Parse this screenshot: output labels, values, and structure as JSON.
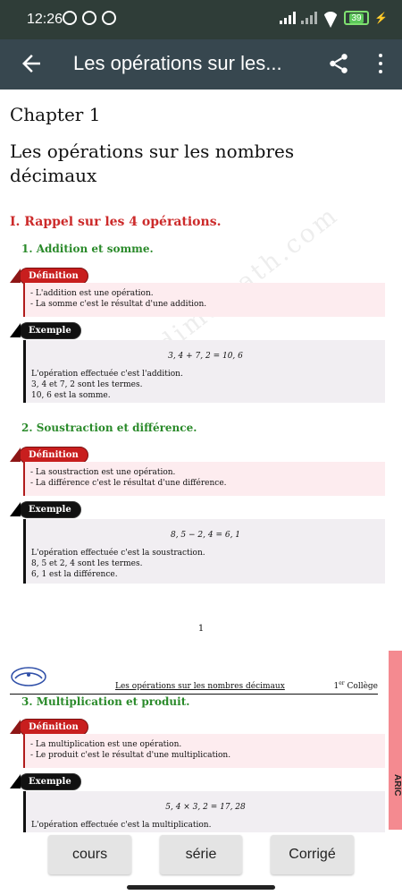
{
  "status_bar": {
    "time": "12:26",
    "battery": "39"
  },
  "app_bar": {
    "title": "Les opérations sur les..."
  },
  "document": {
    "chapter": "Chapter 1",
    "title": "Les opérations sur les nombres décimaux",
    "section": "I.  Rappel sur les 4 opérations.",
    "watermark": "www.dimamath.com",
    "subsections": [
      {
        "heading": "1.  Addition et somme.",
        "definition_label": "Définition",
        "definition_lines": [
          "- L'addition est une opération.",
          "- La somme c'est le résultat d'une addition."
        ],
        "example_label": "Exemple",
        "equation": "3, 4 + 7, 2 = 10, 6",
        "example_lines": [
          "L'opération effectuée c'est l'addition.",
          "3, 4 et 7, 2 sont les termes.",
          "10, 6 est la somme."
        ]
      },
      {
        "heading": "2.  Soustraction et différence.",
        "definition_label": "Définition",
        "definition_lines": [
          "- La soustraction est une opération.",
          "- La différence c'est le résultat d'une différence."
        ],
        "example_label": "Exemple",
        "equation": "8, 5 − 2, 4 = 6, 1",
        "example_lines": [
          "L'opération effectuée c'est la soustraction.",
          "8, 5 et 2, 4 sont les termes.",
          "6, 1 est la différence."
        ]
      },
      {
        "heading": "3.  Multiplication et produit.",
        "definition_label": "Définition",
        "definition_lines": [
          "- La multiplication est une opération.",
          "- Le produit c'est le résultat d'une multiplication."
        ],
        "example_label": "Exemple",
        "equation": "5, 4 × 3, 2 = 17, 28",
        "example_lines": [
          "L'opération effectuée c'est la multiplication."
        ]
      }
    ],
    "page_number": "1",
    "running_header": {
      "title": "Les opérations sur les nombres décimaux",
      "level_prefix": "1",
      "level_sup": "er",
      "level_suffix": " Collège"
    },
    "side_tab": "ARIC"
  },
  "buttons": {
    "cours": "cours",
    "serie": "série",
    "corrige": "Corrigé"
  },
  "colors": {
    "status_bar": "#2f3d38",
    "app_bar": "#37474f",
    "section_red": "#cc2a2a",
    "subsection_green": "#2a8a2a",
    "definition_bg": "#fdecef",
    "example_bg": "#f1eef2",
    "side_tab": "#f48a90"
  }
}
